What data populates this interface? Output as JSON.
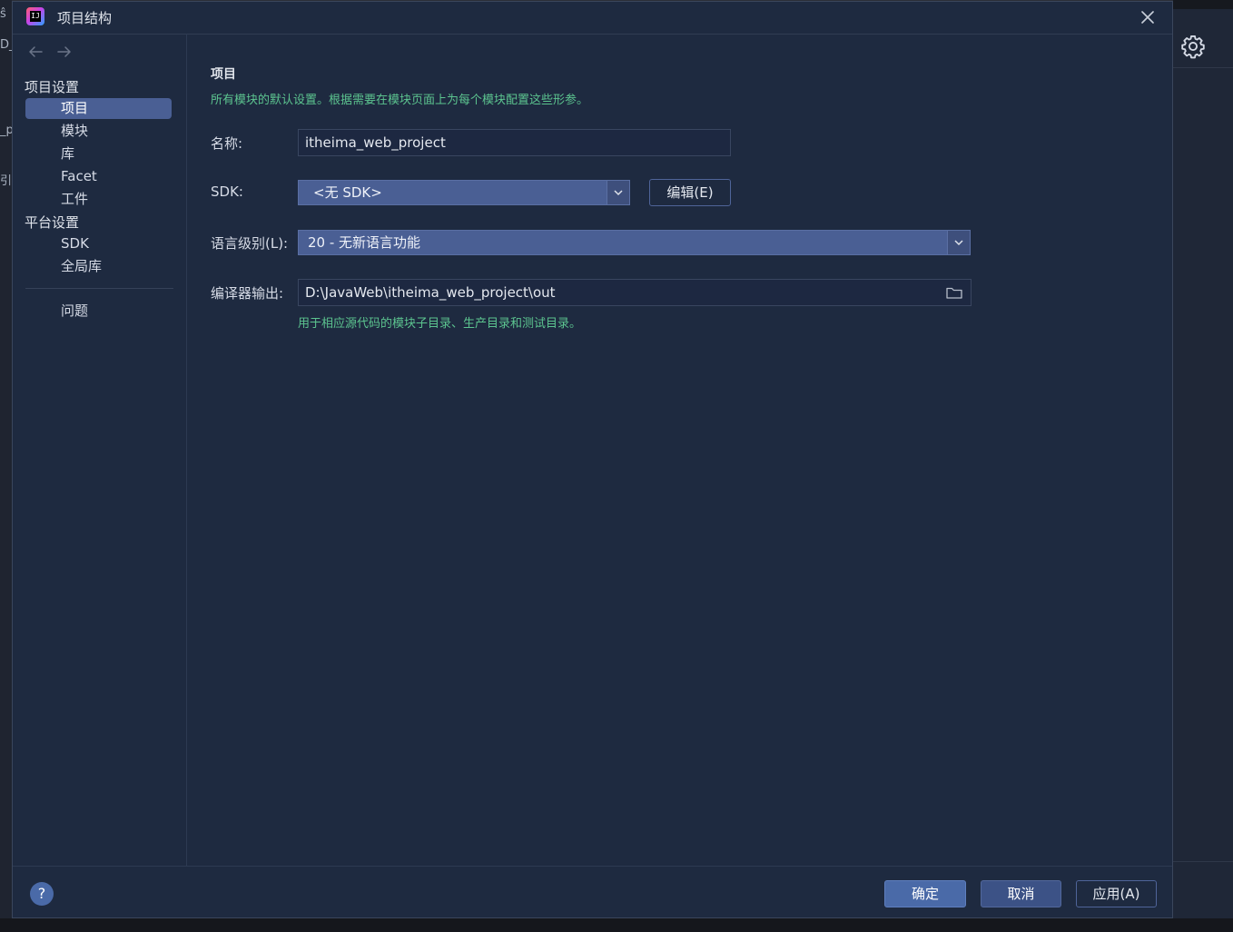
{
  "background": {
    "left_fragments": [
      "ŝ",
      "D_",
      "_p",
      "引台"
    ]
  },
  "dialog": {
    "title": "项目结构",
    "close_icon": "close-icon"
  },
  "sidebar": {
    "groups": [
      {
        "label": "项目设置",
        "items": [
          {
            "label": "项目",
            "selected": true
          },
          {
            "label": "模块"
          },
          {
            "label": "库"
          },
          {
            "label": "Facet"
          },
          {
            "label": "工件"
          }
        ]
      },
      {
        "label": "平台设置",
        "items": [
          {
            "label": "SDK"
          },
          {
            "label": "全局库"
          }
        ]
      }
    ],
    "problems": "问题"
  },
  "main": {
    "title": "项目",
    "description": "所有模块的默认设置。根据需要在模块页面上为每个模块配置这些形参。",
    "name_label": "名称:",
    "name_value": "itheima_web_project",
    "sdk_label": "SDK:",
    "sdk_value": "<无 SDK>",
    "sdk_edit_button": "编辑(E)",
    "language_level_label": "语言级别(L):",
    "language_level_value": "20 - 无新语言功能",
    "compiler_output_label": "编译器输出:",
    "compiler_output_value": "D:\\JavaWeb\\itheima_web_project\\out",
    "compiler_output_hint": "用于相应源代码的模块子目录、生产目录和测试目录。"
  },
  "footer": {
    "help": "?",
    "ok": "确定",
    "cancel": "取消",
    "apply": "应用(A)"
  },
  "colors": {
    "dialog_bg": "#1e2a40",
    "accent": "#4a5f94",
    "hint_green": "#5cc48f"
  }
}
